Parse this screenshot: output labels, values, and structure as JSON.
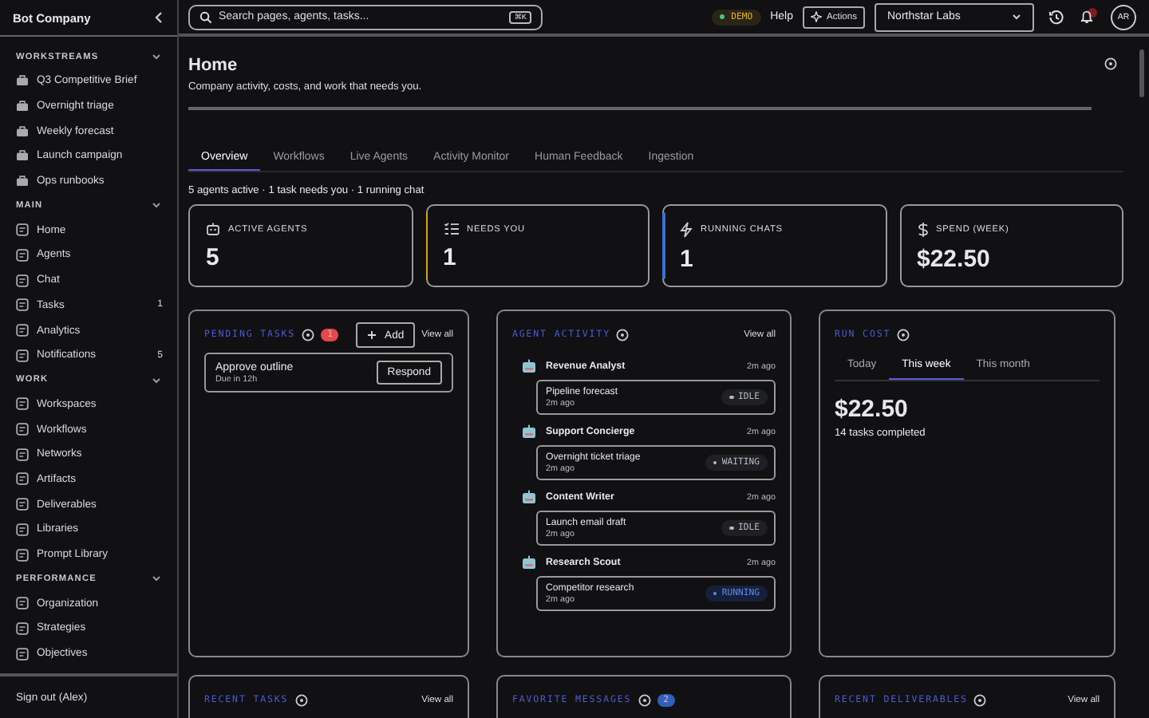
{
  "sidebar": {
    "title": "Bot Company",
    "sections": [
      {
        "label": "WORKSTREAMS",
        "expanded": true,
        "items": [
          {
            "label": "Q3 Competitive Brief",
            "kind": "workstream"
          },
          {
            "label": "Overnight triage",
            "kind": "workstream"
          },
          {
            "label": "Weekly forecast",
            "kind": "workstream"
          },
          {
            "label": "Launch campaign",
            "kind": "workstream"
          },
          {
            "label": "Ops runbooks",
            "kind": "workstream"
          }
        ]
      },
      {
        "label": "MAIN",
        "expanded": true,
        "items": [
          {
            "label": "Home",
            "kind": "page"
          },
          {
            "label": "Agents",
            "kind": "page"
          },
          {
            "label": "Chat",
            "kind": "page"
          },
          {
            "label": "Tasks",
            "kind": "page",
            "count": "1"
          },
          {
            "label": "Analytics",
            "kind": "page"
          },
          {
            "label": "Notifications",
            "kind": "page",
            "count": "5"
          }
        ]
      },
      {
        "label": "WORK",
        "expanded": true,
        "items": [
          {
            "label": "Workspaces",
            "kind": "page"
          },
          {
            "label": "Workflows",
            "kind": "page"
          },
          {
            "label": "Networks",
            "kind": "page"
          },
          {
            "label": "Artifacts",
            "kind": "page"
          },
          {
            "label": "Deliverables",
            "kind": "page"
          },
          {
            "label": "Libraries",
            "kind": "page"
          },
          {
            "label": "Prompt Library",
            "kind": "page"
          }
        ]
      },
      {
        "label": "PERFORMANCE",
        "expanded": true,
        "items": [
          {
            "label": "Organization",
            "kind": "page"
          },
          {
            "label": "Strategies",
            "kind": "page"
          },
          {
            "label": "Objectives",
            "kind": "page"
          }
        ]
      }
    ],
    "footer": "Sign out (Alex)"
  },
  "topbar": {
    "search": {
      "placeholder": "Search pages, agents, tasks...",
      "shortcut": "⌘K"
    },
    "demo": "DEMO",
    "help": "Help",
    "actions": "Actions",
    "org": "Northstar Labs",
    "avatar": "AR"
  },
  "page": {
    "title": "Home",
    "subtitle": "Company activity, costs, and work that needs you."
  },
  "tabs": [
    {
      "label": "Overview",
      "selected": true
    },
    {
      "label": "Workflows",
      "selected": false
    },
    {
      "label": "Live Agents",
      "selected": false
    },
    {
      "label": "Activity Monitor",
      "selected": false
    },
    {
      "label": "Human Feedback",
      "selected": false
    },
    {
      "label": "Ingestion",
      "selected": false
    }
  ],
  "summary": "5 agents active · 1 task needs you · 1 running chat",
  "stats": [
    {
      "label": "ACTIVE AGENTS",
      "value": "5",
      "kind": "agents"
    },
    {
      "label": "NEEDS YOU",
      "value": "1",
      "kind": "tasks",
      "color": "#d9a21b"
    },
    {
      "label": "RUNNING CHATS",
      "value": "1",
      "kind": "chats",
      "color": "#3b6fd8"
    },
    {
      "label": "SPEND (WEEK)",
      "value": "$22.50",
      "kind": "spend"
    }
  ],
  "pending_tasks": {
    "title": "PENDING TASKS",
    "badge": {
      "label": "1",
      "color": "#e5484d"
    },
    "add": "Add",
    "view_all": "View all",
    "items": [
      {
        "title": "Approve outline",
        "due": "Due in 12h",
        "action": "Respond"
      }
    ]
  },
  "agent_activity": {
    "title": "AGENT ACTIVITY",
    "view_all": "View all",
    "agents": [
      {
        "name": "Revenue Analyst",
        "time": "2m ago",
        "task": "Pipeline forecast",
        "task_time": "2m ago",
        "status": "IDLE",
        "kind": "idle"
      },
      {
        "name": "Support Concierge",
        "time": "2m ago",
        "task": "Overnight ticket triage",
        "task_time": "2m ago",
        "status": "WAITING",
        "kind": "idle"
      },
      {
        "name": "Content Writer",
        "time": "2m ago",
        "task": "Launch email draft",
        "task_time": "2m ago",
        "status": "IDLE",
        "kind": "idle"
      },
      {
        "name": "Research Scout",
        "time": "2m ago",
        "task": "Competitor research",
        "task_time": "2m ago",
        "status": "RUNNING",
        "kind": "running"
      }
    ]
  },
  "run_cost": {
    "title": "RUN COST",
    "tabs": [
      {
        "label": "Today",
        "selected": false
      },
      {
        "label": "This week",
        "selected": true
      },
      {
        "label": "This month",
        "selected": false
      }
    ],
    "amount": "$22.50",
    "note": "14 tasks completed"
  },
  "bottom_panels": [
    {
      "title": "RECENT TASKS",
      "view_all": "View all"
    },
    {
      "title": "FAVORITE MESSAGES",
      "badge": {
        "label": "2",
        "color": "#2f5fbf"
      }
    },
    {
      "title": "RECENT DELIVERABLES",
      "view_all": "View all"
    }
  ]
}
